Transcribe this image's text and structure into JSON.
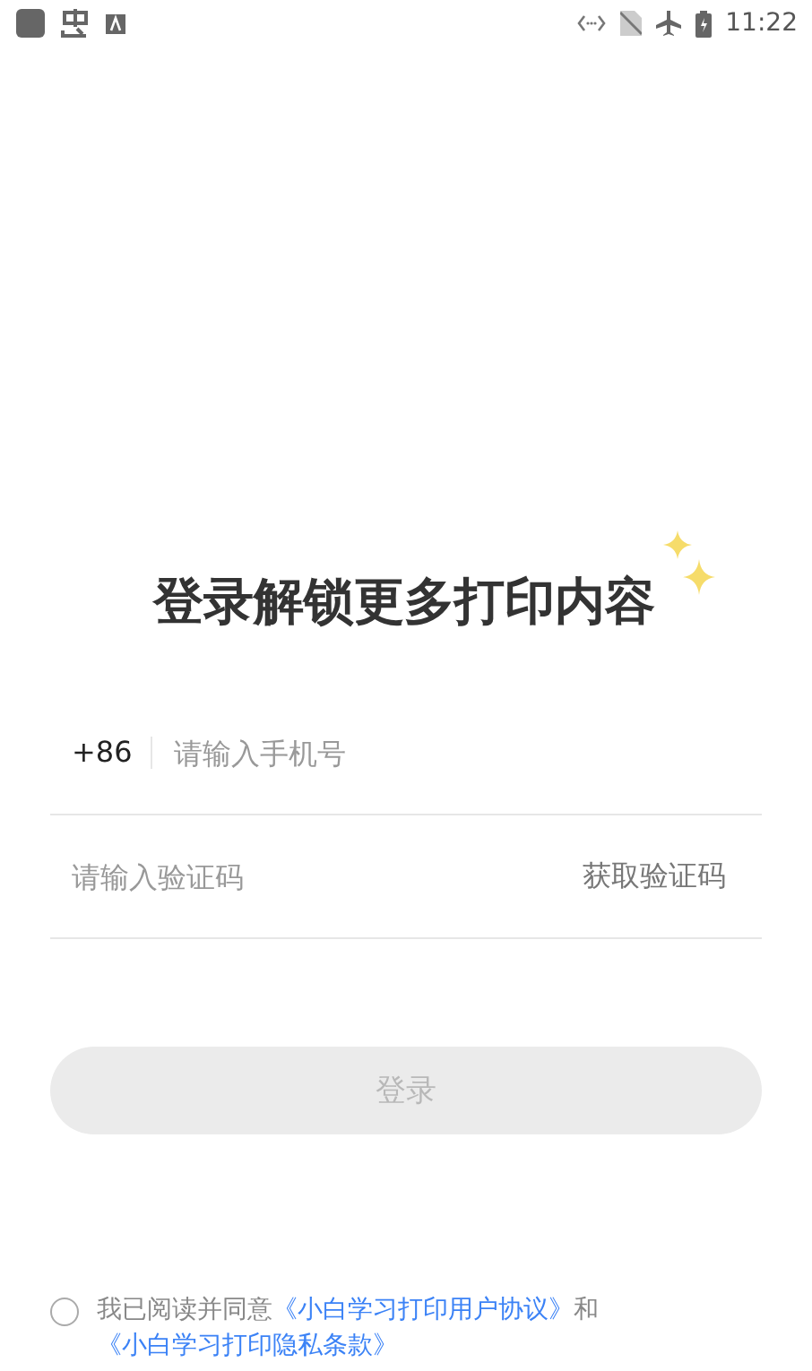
{
  "status_bar": {
    "time": "11:22"
  },
  "title": "登录解锁更多打印内容",
  "phone_field": {
    "country_code": "+86",
    "placeholder": "请输入手机号"
  },
  "code_field": {
    "placeholder": "请输入验证码",
    "action": "获取验证码"
  },
  "login_button": {
    "label": "登录",
    "disabled": true
  },
  "agreement": {
    "checked": false,
    "text": "我已阅读并同意",
    "links": [
      "《小白学习打印用户协议》",
      "《小白学习打印隐私条款》"
    ],
    "joiner": "和"
  }
}
